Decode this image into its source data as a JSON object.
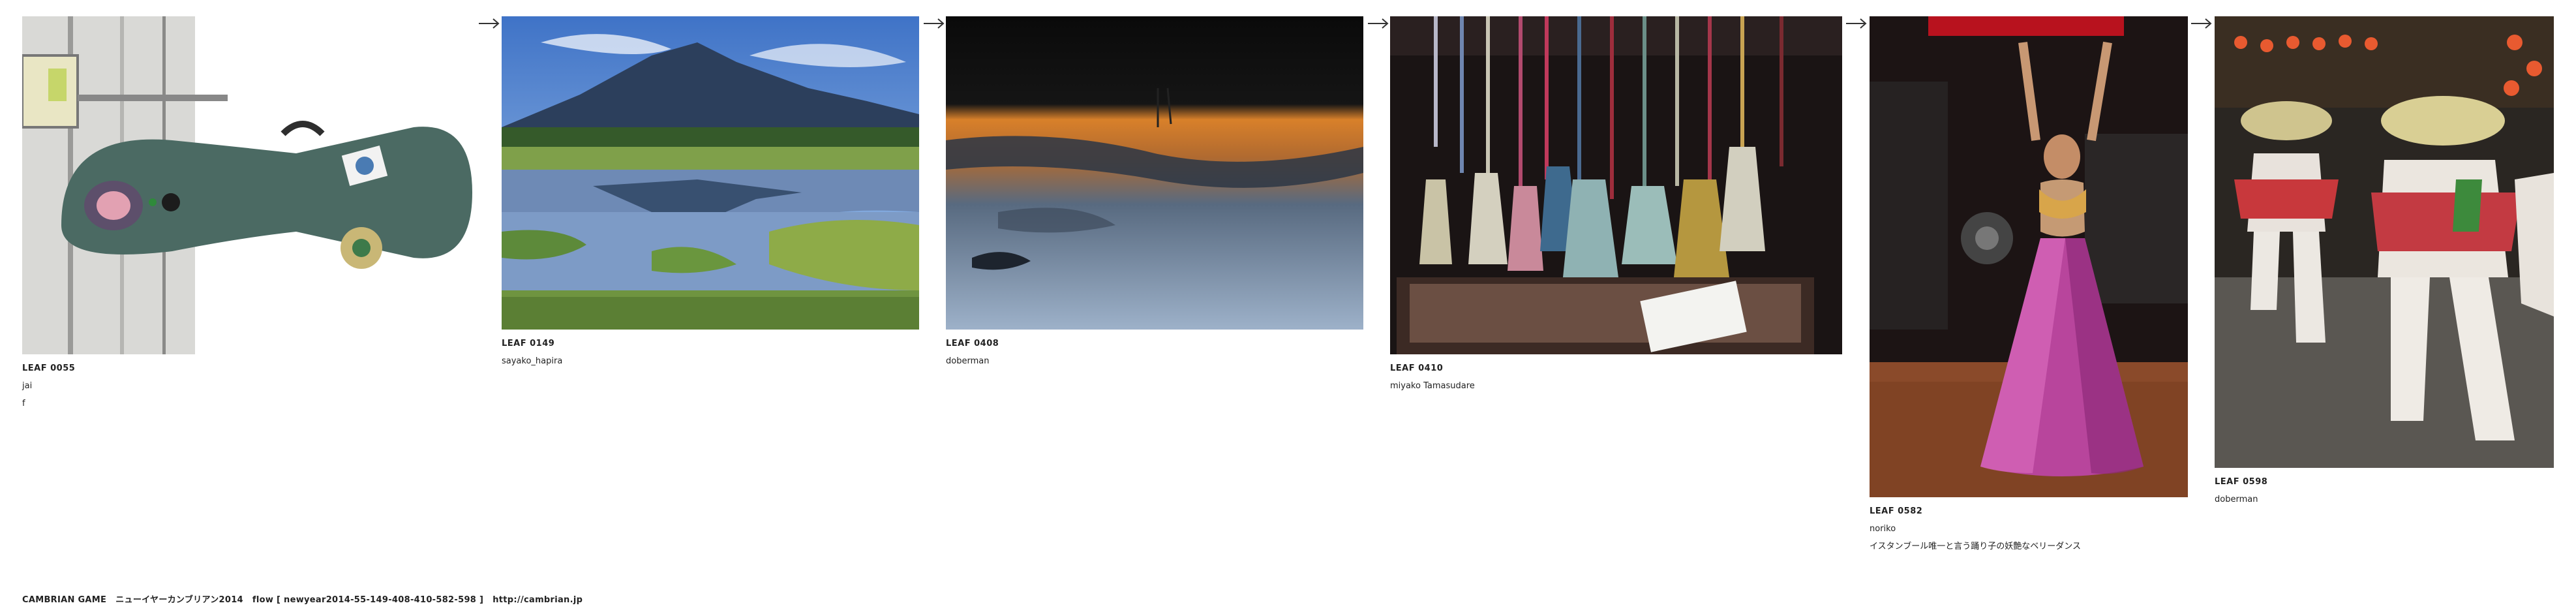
{
  "leaves": [
    {
      "id": "LEAF 0055",
      "author": "jai",
      "comment": "f"
    },
    {
      "id": "LEAF 0149",
      "author": "sayako_hapira",
      "comment": ""
    },
    {
      "id": "LEAF 0408",
      "author": "doberman",
      "comment": ""
    },
    {
      "id": "LEAF 0410",
      "author": "miyako Tamasudare",
      "comment": ""
    },
    {
      "id": "LEAF 0582",
      "author": "noriko",
      "comment": "イスタンブール唯一と言う踊り子の妖艶なベリーダンス"
    },
    {
      "id": "LEAF 0598",
      "author": "doberman",
      "comment": ""
    }
  ],
  "arrow_glyph": "→",
  "footer": {
    "brand": "CAMBRIAN GAME",
    "title": "ニューイヤーカンブリアン2014",
    "flow": "flow [ newyear2014-55-149-408-410-582-598 ]",
    "url": "http://cambrian.jp"
  },
  "icons": [
    "arrow-right-icon"
  ],
  "colors": {
    "text": "#222222",
    "background": "#ffffff"
  }
}
